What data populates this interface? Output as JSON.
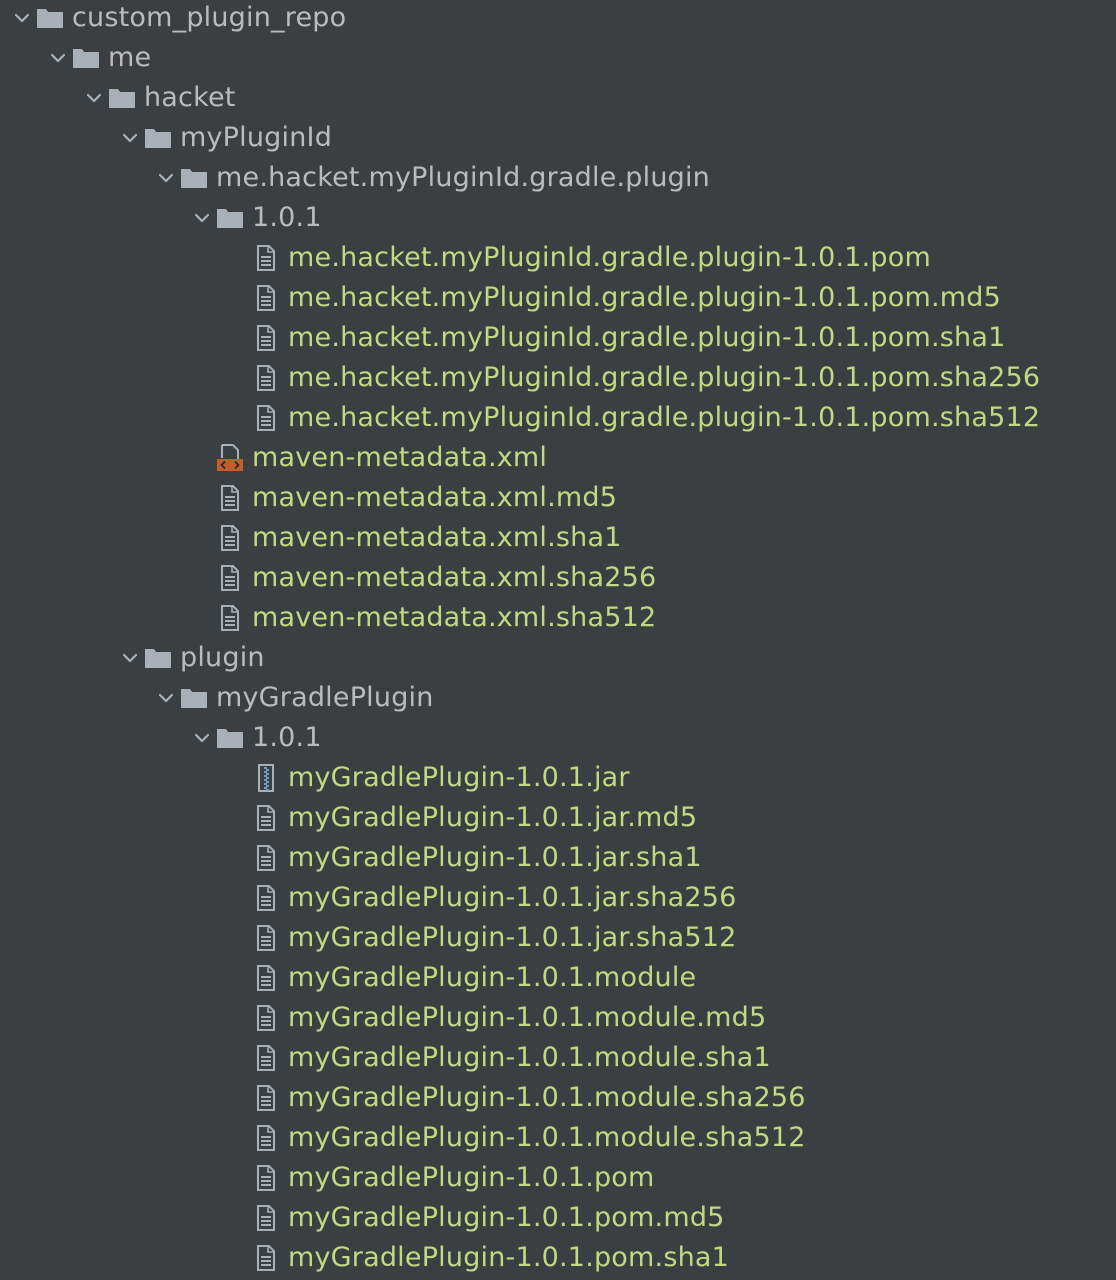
{
  "tree": [
    {
      "label": "custom_plugin_repo",
      "type": "folder",
      "depth": 0,
      "expanded": true
    },
    {
      "label": "me",
      "type": "folder",
      "depth": 1,
      "expanded": true
    },
    {
      "label": "hacket",
      "type": "folder",
      "depth": 2,
      "expanded": true
    },
    {
      "label": "myPluginId",
      "type": "folder",
      "depth": 3,
      "expanded": true
    },
    {
      "label": "me.hacket.myPluginId.gradle.plugin",
      "type": "folder",
      "depth": 4,
      "expanded": true
    },
    {
      "label": "1.0.1",
      "type": "folder",
      "depth": 5,
      "expanded": true
    },
    {
      "label": "me.hacket.myPluginId.gradle.plugin-1.0.1.pom",
      "type": "file",
      "icon": "text-file-icon",
      "depth": 6
    },
    {
      "label": "me.hacket.myPluginId.gradle.plugin-1.0.1.pom.md5",
      "type": "file",
      "icon": "text-file-icon",
      "depth": 6
    },
    {
      "label": "me.hacket.myPluginId.gradle.plugin-1.0.1.pom.sha1",
      "type": "file",
      "icon": "text-file-icon",
      "depth": 6
    },
    {
      "label": "me.hacket.myPluginId.gradle.plugin-1.0.1.pom.sha256",
      "type": "file",
      "icon": "text-file-icon",
      "depth": 6
    },
    {
      "label": "me.hacket.myPluginId.gradle.plugin-1.0.1.pom.sha512",
      "type": "file",
      "icon": "text-file-icon",
      "depth": 6
    },
    {
      "label": "maven-metadata.xml",
      "type": "file",
      "icon": "xml-file-icon",
      "depth": 5
    },
    {
      "label": "maven-metadata.xml.md5",
      "type": "file",
      "icon": "text-file-icon",
      "depth": 5
    },
    {
      "label": "maven-metadata.xml.sha1",
      "type": "file",
      "icon": "text-file-icon",
      "depth": 5
    },
    {
      "label": "maven-metadata.xml.sha256",
      "type": "file",
      "icon": "text-file-icon",
      "depth": 5
    },
    {
      "label": "maven-metadata.xml.sha512",
      "type": "file",
      "icon": "text-file-icon",
      "depth": 5
    },
    {
      "label": "plugin",
      "type": "folder",
      "depth": 3,
      "expanded": true
    },
    {
      "label": "myGradlePlugin",
      "type": "folder",
      "depth": 4,
      "expanded": true
    },
    {
      "label": "1.0.1",
      "type": "folder",
      "depth": 5,
      "expanded": true
    },
    {
      "label": "myGradlePlugin-1.0.1.jar",
      "type": "file",
      "icon": "archive-file-icon",
      "depth": 6
    },
    {
      "label": "myGradlePlugin-1.0.1.jar.md5",
      "type": "file",
      "icon": "text-file-icon",
      "depth": 6
    },
    {
      "label": "myGradlePlugin-1.0.1.jar.sha1",
      "type": "file",
      "icon": "text-file-icon",
      "depth": 6
    },
    {
      "label": "myGradlePlugin-1.0.1.jar.sha256",
      "type": "file",
      "icon": "text-file-icon",
      "depth": 6
    },
    {
      "label": "myGradlePlugin-1.0.1.jar.sha512",
      "type": "file",
      "icon": "text-file-icon",
      "depth": 6
    },
    {
      "label": "myGradlePlugin-1.0.1.module",
      "type": "file",
      "icon": "text-file-icon",
      "depth": 6
    },
    {
      "label": "myGradlePlugin-1.0.1.module.md5",
      "type": "file",
      "icon": "text-file-icon",
      "depth": 6
    },
    {
      "label": "myGradlePlugin-1.0.1.module.sha1",
      "type": "file",
      "icon": "text-file-icon",
      "depth": 6
    },
    {
      "label": "myGradlePlugin-1.0.1.module.sha256",
      "type": "file",
      "icon": "text-file-icon",
      "depth": 6
    },
    {
      "label": "myGradlePlugin-1.0.1.module.sha512",
      "type": "file",
      "icon": "text-file-icon",
      "depth": 6
    },
    {
      "label": "myGradlePlugin-1.0.1.pom",
      "type": "file",
      "icon": "text-file-icon",
      "depth": 6
    },
    {
      "label": "myGradlePlugin-1.0.1.pom.md5",
      "type": "file",
      "icon": "text-file-icon",
      "depth": 6
    },
    {
      "label": "myGradlePlugin-1.0.1.pom.sha1",
      "type": "file",
      "icon": "text-file-icon",
      "depth": 6
    }
  ],
  "colors": {
    "background": "#3c3f41",
    "folder_text": "#bbbbbb",
    "file_text": "#c3d884",
    "folder_icon": "#a9b0b7",
    "xml_icon": "#c25e2c"
  }
}
